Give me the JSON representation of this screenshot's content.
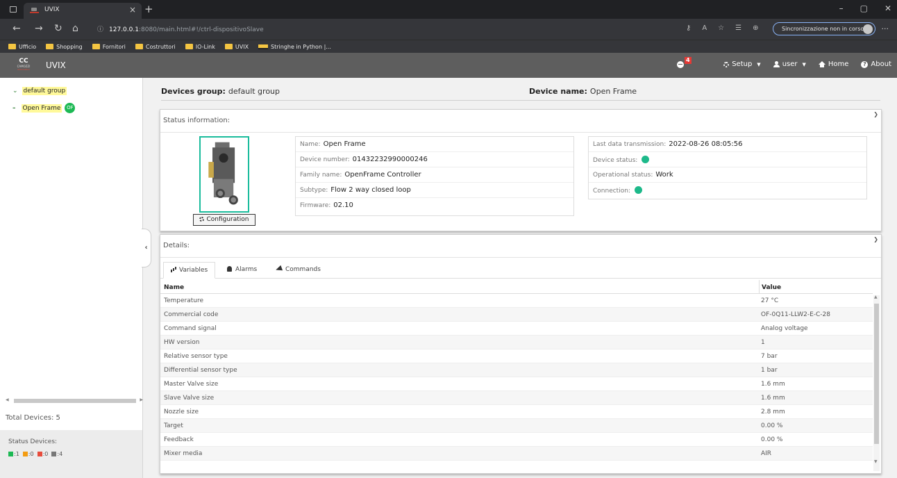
{
  "browser": {
    "tab_title": "UVIX",
    "tab_close": "×",
    "new_tab": "+",
    "window_controls": [
      "–",
      "▢",
      "✕"
    ],
    "url_host": "127.0.0.1",
    "url_path": ":8080/main.html#!/ctrl-dispositivoSlave",
    "sync_label": "Sincronizzazione non in corso",
    "more": "···",
    "bookmarks": [
      "Ufficio",
      "Shopping",
      "Fornitori",
      "Costruttori",
      "IO-Link",
      "UVIX",
      "Stringhe in Python |..."
    ]
  },
  "app": {
    "title": "UVIX",
    "logo_letters": "CC",
    "logo_text": "CAMOZZI",
    "logo_sub": "Automation",
    "notification_count": "4",
    "nav": {
      "setup": "Setup",
      "user": "user",
      "home": "Home",
      "about": "About"
    }
  },
  "sidebar": {
    "group_label": "default group",
    "device_label": "Open Frame",
    "device_badge": "OF",
    "total_devices": "Total Devices: 5",
    "status_title": "Status Devices:",
    "status_counts": [
      {
        "color": "#1db954",
        "value": "1"
      },
      {
        "color": "#f39c12",
        "value": "0"
      },
      {
        "color": "#e74c3c",
        "value": "0"
      },
      {
        "color": "#777777",
        "value": "4"
      }
    ]
  },
  "header": {
    "group_key": "Devices group:",
    "group_value": "default group",
    "device_key": "Device name:",
    "device_value": "Open Frame"
  },
  "status": {
    "title": "Status information:",
    "config_button": "Configuration",
    "left_rows": [
      {
        "label": "Name:",
        "value": "Open Frame"
      },
      {
        "label": "Device number:",
        "value": "01432232990000246"
      },
      {
        "label": "Family name:",
        "value": "OpenFrame Controller"
      },
      {
        "label": "Subtype:",
        "value": "Flow 2 way closed loop"
      },
      {
        "label": "Firmware:",
        "value": "02.10"
      }
    ],
    "right_rows": [
      {
        "label": "Last data transmission:",
        "value": "2022-08-26 08:05:56"
      },
      {
        "label": "Device status:",
        "value": ""
      },
      {
        "label": "Operational status:",
        "value": "Work"
      },
      {
        "label": "Connection:",
        "value": ""
      }
    ],
    "ok_color": "#1db98a"
  },
  "details": {
    "title": "Details:",
    "tabs": [
      "Variables",
      "Alarms",
      "Commands"
    ],
    "columns": [
      "Name",
      "Value"
    ],
    "rows": [
      {
        "name": "Temperature",
        "value": "27 °C"
      },
      {
        "name": "Commercial code",
        "value": "OF-0Q11-LLW2-E-C-28"
      },
      {
        "name": "Command signal",
        "value": "Analog voltage"
      },
      {
        "name": "HW version",
        "value": "1"
      },
      {
        "name": "Relative sensor type",
        "value": "7 bar"
      },
      {
        "name": "Differential sensor type",
        "value": "1 bar"
      },
      {
        "name": "Master Valve size",
        "value": "1.6 mm"
      },
      {
        "name": "Slave Valve size",
        "value": "1.6 mm"
      },
      {
        "name": "Nozzle size",
        "value": "2.8 mm"
      },
      {
        "name": "Target",
        "value": "0.00 %"
      },
      {
        "name": "Feedback",
        "value": "0.00 %"
      },
      {
        "name": "Mixer media",
        "value": "AIR"
      }
    ]
  }
}
